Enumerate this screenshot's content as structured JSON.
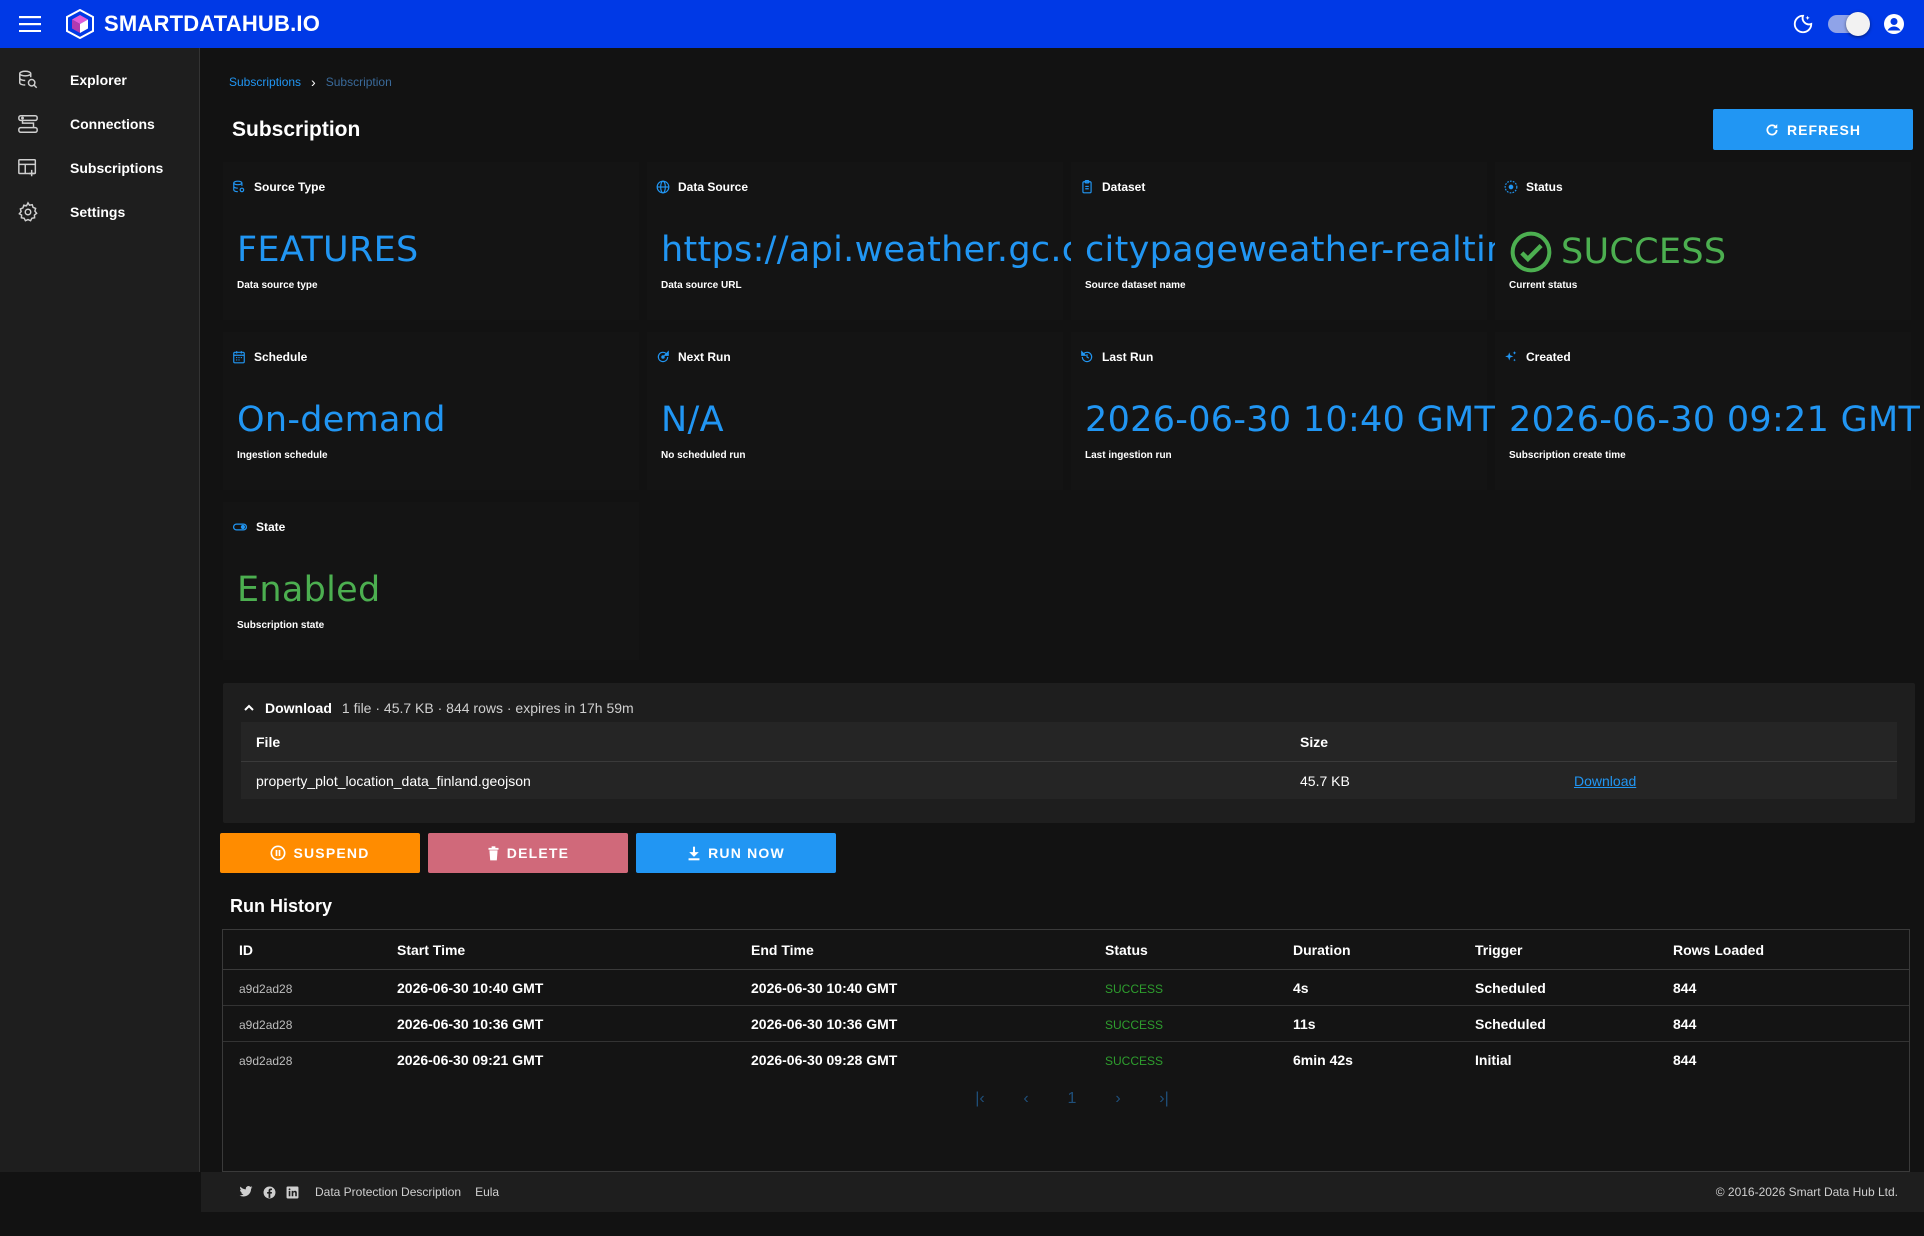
{
  "app": {
    "brand": "SMARTDATAHUB.IO"
  },
  "colors": {
    "topbar": "#0039e6",
    "accent": "#2196f3",
    "success": "#4caf50",
    "suspend": "#ff8c00",
    "delete": "#d0697a"
  },
  "sidebar": {
    "items": [
      {
        "label": "Explorer",
        "icon": "explorer-icon"
      },
      {
        "label": "Connections",
        "icon": "connections-icon"
      },
      {
        "label": "Subscriptions",
        "icon": "subscriptions-icon"
      },
      {
        "label": "Settings",
        "icon": "gear-icon"
      }
    ]
  },
  "breadcrumb": {
    "parent": "Subscriptions",
    "current": "Subscription"
  },
  "page": {
    "title": "Subscription",
    "refresh_label": "REFRESH"
  },
  "cards": [
    {
      "title": "Source Type",
      "value": "FEATURES",
      "sub": "Data source type",
      "icon": "database-icon"
    },
    {
      "title": "Data Source",
      "value": "https://api.weather.gc.ca",
      "sub": "Data source URL",
      "icon": "globe-icon"
    },
    {
      "title": "Dataset",
      "value": "citypageweather-realtime",
      "sub": "Source dataset name",
      "icon": "clipboard-icon"
    },
    {
      "title": "Status",
      "value": "SUCCESS",
      "sub": "Current status",
      "icon": "status-icon"
    },
    {
      "title": "Schedule",
      "value": "On-demand",
      "sub": "Ingestion schedule",
      "icon": "calendar-icon"
    },
    {
      "title": "Next Run",
      "value": "N/A",
      "sub": "No scheduled run",
      "icon": "next-run-icon"
    },
    {
      "title": "Last Run",
      "value": "2026-06-30 10:40 GMT",
      "sub": "Last ingestion run",
      "icon": "history-icon"
    },
    {
      "title": "Created",
      "value": "2026-06-30 09:21 GMT",
      "sub": "Subscription create time",
      "icon": "sparkle-icon"
    },
    {
      "title": "State",
      "value": "Enabled",
      "sub": "Subscription state",
      "icon": "toggle-icon"
    }
  ],
  "download": {
    "title": "Download",
    "meta": "1 file · 45.7 KB · 844 rows · expires in 17h 59m",
    "headers": {
      "file": "File",
      "size": "Size"
    },
    "rows": [
      {
        "file": "property_plot_location_data_finland.geojson",
        "size": "45.7 KB",
        "action": "Download"
      }
    ]
  },
  "actions": {
    "suspend": "SUSPEND",
    "delete": "DELETE",
    "run_now": "RUN NOW"
  },
  "run_history": {
    "title": "Run History",
    "headers": [
      "ID",
      "Start Time",
      "End Time",
      "Status",
      "Duration",
      "Trigger",
      "Rows Loaded"
    ],
    "rows": [
      {
        "id": "a9d2ad28",
        "start": "2026-06-30 10:40 GMT",
        "end": "2026-06-30 10:40 GMT",
        "status": "SUCCESS",
        "duration": "4s",
        "trigger": "Scheduled",
        "rows": "844"
      },
      {
        "id": "a9d2ad28",
        "start": "2026-06-30 10:36 GMT",
        "end": "2026-06-30 10:36 GMT",
        "status": "SUCCESS",
        "duration": "11s",
        "trigger": "Scheduled",
        "rows": "844"
      },
      {
        "id": "a9d2ad28",
        "start": "2026-06-30 09:21 GMT",
        "end": "2026-06-30 09:28 GMT",
        "status": "SUCCESS",
        "duration": "6min 42s",
        "trigger": "Initial",
        "rows": "844"
      }
    ],
    "pager": {
      "first": "|‹",
      "prev": "‹",
      "page": "1",
      "next": "›",
      "last": "›|"
    }
  },
  "footer": {
    "links": [
      "Data Protection Description",
      "Eula"
    ],
    "copyright": "© 2016-2026 Smart Data Hub Ltd."
  }
}
